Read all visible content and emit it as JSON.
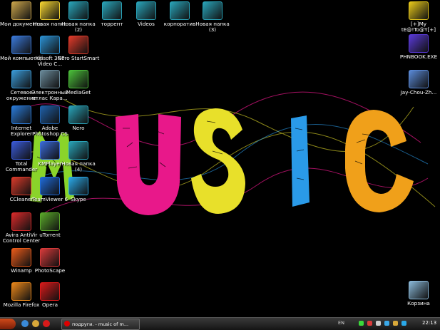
{
  "desktop": {
    "icons": [
      {
        "label": "Мои документы",
        "icon": "folder-documents-icon",
        "color": "#c8a24a"
      },
      {
        "label": "Новая папка",
        "icon": "warning-folder-icon",
        "color": "#f2d230"
      },
      {
        "label": "Новая папка (2)",
        "icon": "folder-icon",
        "color": "#29a3b8"
      },
      {
        "label": "торрент",
        "icon": "folder-icon",
        "color": "#29a3b8"
      },
      {
        "label": "Videos",
        "icon": "folder-icon",
        "color": "#29a3b8"
      },
      {
        "label": "корпоратив",
        "icon": "folder-icon",
        "color": "#29a3b8"
      },
      {
        "label": "Новая папка (3)",
        "icon": "folder-icon",
        "color": "#29a3b8"
      },
      {
        "label": "Мой компьютер",
        "icon": "computer-icon",
        "color": "#3a78d8"
      },
      {
        "label": "Xilisoft 3GP Video C...",
        "icon": "xilisoft-icon",
        "color": "#2b8fd0"
      },
      {
        "label": "Nero StartSmart",
        "icon": "nero-icon",
        "color": "#e03a2a"
      },
      {
        "label": "Сетевое окружение",
        "icon": "network-icon",
        "color": "#3a9ad8"
      },
      {
        "label": "Электронный атлас Кара...",
        "icon": "globe-icon",
        "color": "#6a8a9a"
      },
      {
        "label": "MediaGet",
        "icon": "mediaget-icon",
        "color": "#4bbf3a"
      },
      {
        "label": "Internet Explorer",
        "icon": "internet-explorer-icon",
        "color": "#2a7ad8"
      },
      {
        "label": "Adobe Photoshop CS",
        "icon": "photoshop-icon",
        "color": "#1f5fa8"
      },
      {
        "label": "Nero",
        "icon": "folder-icon",
        "color": "#29a3b8"
      },
      {
        "label": "Total Commander",
        "icon": "floppy-icon",
        "color": "#3a5ad8"
      },
      {
        "label": "KMPlayer",
        "icon": "snowflake-icon",
        "color": "#3a6ad8"
      },
      {
        "label": "Новая папка (4)",
        "icon": "folder-icon",
        "color": "#29a3b8"
      },
      {
        "label": "CCleaner",
        "icon": "ccleaner-icon",
        "color": "#d83a2a"
      },
      {
        "label": "TeamViewer 6",
        "icon": "teamviewer-icon",
        "color": "#1f6ad8"
      },
      {
        "label": "Skype",
        "icon": "skype-icon",
        "color": "#2aa8e8"
      },
      {
        "label": "Avira AntiVir Control Center",
        "icon": "avira-icon",
        "color": "#d82a2a"
      },
      {
        "label": "uTorrent",
        "icon": "utorrent-icon",
        "color": "#5aa82a"
      },
      {
        "label": "Winamp",
        "icon": "winamp-icon",
        "color": "#e85a1a"
      },
      {
        "label": "PhotoScape",
        "icon": "photoscape-icon",
        "color": "#d83a3a"
      },
      {
        "label": "Mozilla Firefox",
        "icon": "firefox-icon",
        "color": "#e8861a"
      },
      {
        "label": "Opera",
        "icon": "opera-icon",
        "color": "#d81a1a"
      },
      {
        "label": "[+]My tE@!To@Y[+]",
        "icon": "star-icon",
        "color": "#e8c81a"
      },
      {
        "label": "PHNBOOK.EXE",
        "icon": "phonebook-icon",
        "color": "#5a3ad8"
      },
      {
        "label": "Jay-Chou-Zh...",
        "icon": "document-icon",
        "color": "#5a8ad8"
      },
      {
        "label": "Корзина",
        "icon": "recycle-bin-icon",
        "color": "#8ab8d8"
      }
    ]
  },
  "wallpaper": {
    "letters": [
      {
        "char": "M",
        "color": "#8ad42a"
      },
      {
        "char": "U",
        "color": "#e8188a"
      },
      {
        "char": "S",
        "color": "#e8e02a"
      },
      {
        "char": "I",
        "color": "#2a9ae8"
      },
      {
        "char": "C",
        "color": "#f0a01a"
      }
    ]
  },
  "taskbar": {
    "start_icon": "start-orb-icon",
    "quicklaunch": [
      {
        "icon": "chrome-icon",
        "color": "#3a8ad8"
      },
      {
        "icon": "browser-icon",
        "color": "#d8a83a"
      },
      {
        "icon": "opera-icon",
        "color": "#d81a1a"
      }
    ],
    "task_label": "подруги. - music of m...",
    "language": "EN",
    "tray": [
      {
        "icon": "network-tray-icon",
        "color": "#3ad83a"
      },
      {
        "icon": "antivirus-tray-icon",
        "color": "#d83a3a"
      },
      {
        "icon": "volume-tray-icon",
        "color": "#cccccc"
      },
      {
        "icon": "update-tray-icon",
        "color": "#3aa8e8"
      },
      {
        "icon": "security-tray-icon",
        "color": "#d8a83a"
      },
      {
        "icon": "skype-tray-icon",
        "color": "#2aa8e8"
      }
    ],
    "clock": "22:13"
  }
}
